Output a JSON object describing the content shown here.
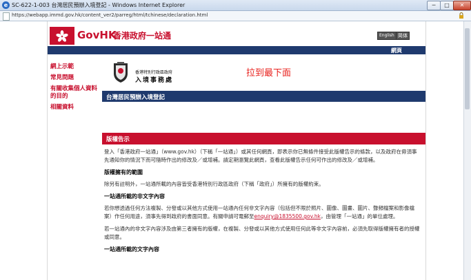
{
  "window": {
    "title": "SC-622-1-003 台灣居民預辦入境登記 - Windows Internet Explorer",
    "url": "https://webapp.immd.gov.hk/content_ver2/parreg/html/tchinese/declaration.html",
    "controls": {
      "minimize": "─",
      "maximize": "□",
      "close": "✕"
    }
  },
  "header": {
    "brand_gov": "Gov",
    "brand_hk": "HK",
    "portal_name": "香港政府一站通",
    "lang_en": "English",
    "lang_sc": "简体"
  },
  "navbar": {
    "sitemap": "網頁"
  },
  "sidebar": {
    "items": [
      {
        "label": "網上示範"
      },
      {
        "label": "常見問題"
      },
      {
        "label": "有關收集個人資料的目的"
      },
      {
        "label": "相關資料"
      }
    ]
  },
  "department": {
    "org": "香港特別行政區政府",
    "name": "入境事務處"
  },
  "annotation": "拉到最下面",
  "app_title": "台灣居民預辦入境登記",
  "notice": {
    "title": "版權告示",
    "p1": "登入「香港政府一站通」（www.gov.hk）（下稱「一站通」）或其任何網頁，即表示你已無條件接受此版權告示的條款，以及政府在毋須事先通知你的情況下而可隨時作出的修改及／或增補。請定期瀏覽此網頁，查看此版權告示任何可作出的修改及／或增補。",
    "h_scope": "版權擁有的範圍",
    "p_scope": "除另有註明外，一站通所載的內容皆受香港特別行政區政府（下稱「政府」）所擁有的版權約束。",
    "h_nontext": "一站通所載的非文字內容",
    "p_nontext_a": "若你想透過任何方法複製、分發或以其他方式使用一站通內任何非文字內容（包括但不限於照片、圖像、圖畫、圖片、聲頻檔案和影像檔案）作任何用途，須事先得到政府的書面同意。有關申請可電郵至",
    "email": "enquiry@1835500.gov.hk",
    "p_nontext_b": "，由管理「一站通」的單位處理。",
    "p_thirdparty": "若一站通內的非文字內容涉及由第三者擁有的版權，在複製、分發或以其他方式使用任何此等非文字內容前，必須先取得版權擁有者的授權或同意。",
    "h_text": "一站通所載的文字內容"
  }
}
